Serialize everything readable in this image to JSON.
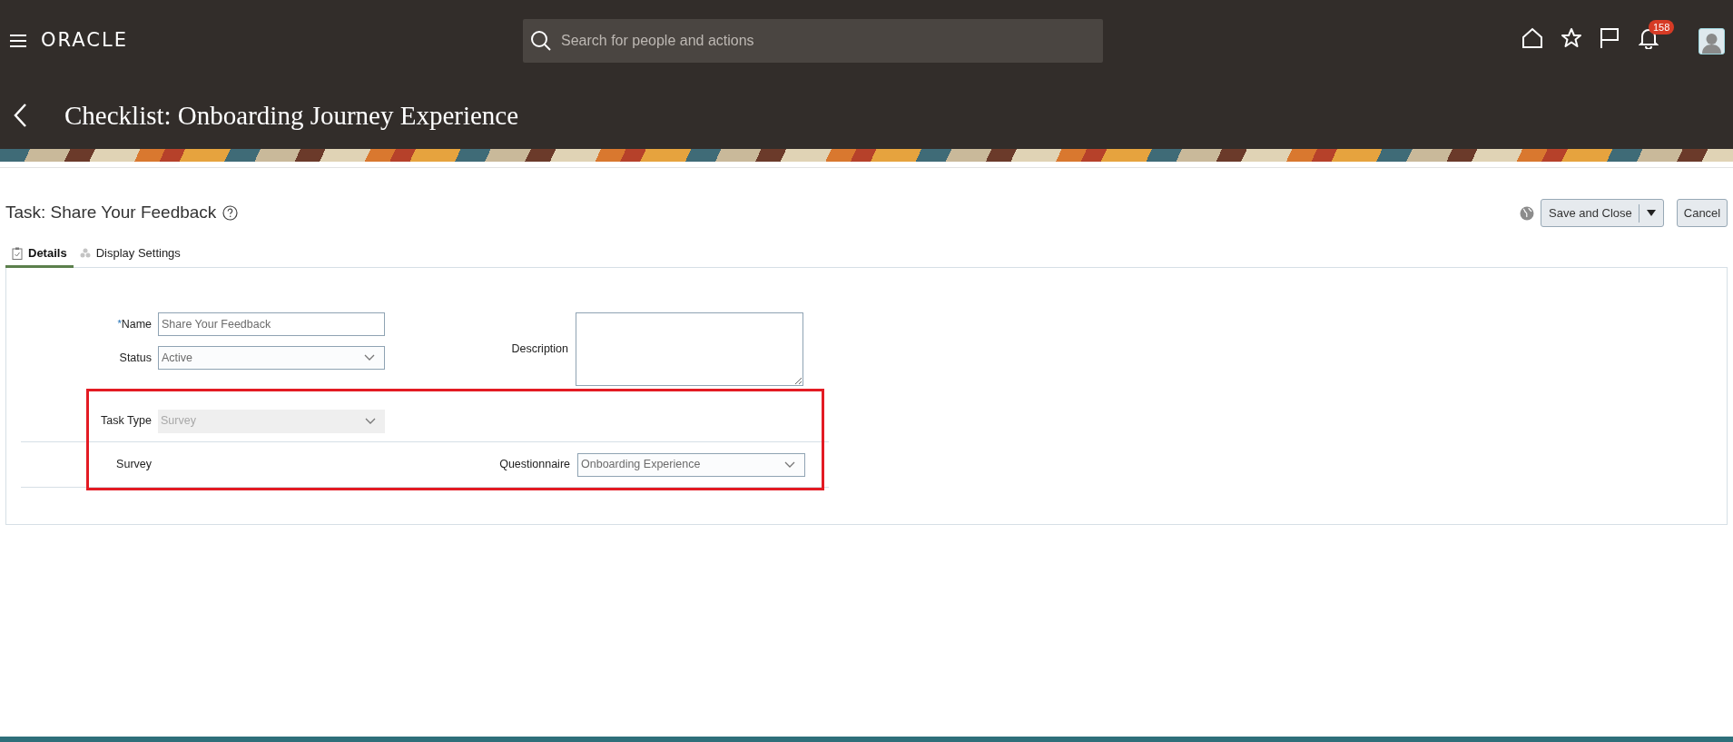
{
  "header": {
    "logo": "ORACLE",
    "search": {
      "placeholder": "Search for people and actions"
    },
    "notification_count": "158"
  },
  "page_title": "Checklist: Onboarding Journey Experience",
  "task_title": "Task: Share Your Feedback",
  "actions": {
    "save": "Save and Close",
    "cancel": "Cancel"
  },
  "tabs": [
    {
      "label": "Details",
      "selected": true
    },
    {
      "label": "Display Settings",
      "selected": false
    }
  ],
  "form": {
    "name": {
      "label": "Name",
      "required_mark": "*",
      "value": "Share Your Feedback"
    },
    "status": {
      "label": "Status",
      "value": "Active"
    },
    "description": {
      "label": "Description"
    },
    "task_type": {
      "label": "Task Type",
      "value": "Survey",
      "disabled": true
    },
    "section_label": "Survey",
    "questionnaire": {
      "label": "Questionnaire",
      "value": "Onboarding Experience"
    }
  }
}
